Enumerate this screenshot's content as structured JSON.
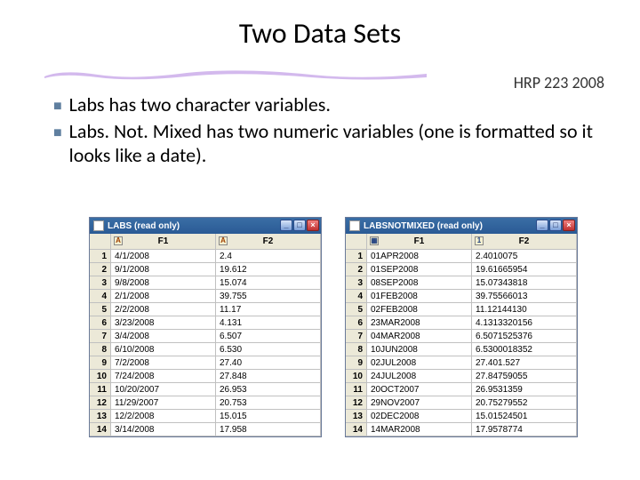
{
  "title": "Two Data Sets",
  "header_tag": "HRP 223 2008",
  "bullets": [
    "Labs has two character variables.",
    "Labs. Not. Mixed has two numeric variables (one is formatted so it looks like a date)."
  ],
  "windows": {
    "left": {
      "title": "LABS (read only)",
      "cols": [
        "F1",
        "F2"
      ],
      "coltypes": [
        "char",
        "char"
      ],
      "rows": [
        [
          "4/1/2008",
          "2.4"
        ],
        [
          "9/1/2008",
          "19.612"
        ],
        [
          "9/8/2008",
          "15.074"
        ],
        [
          "2/1/2008",
          "39.755"
        ],
        [
          "2/2/2008",
          "11.17"
        ],
        [
          "3/23/2008",
          "4.131"
        ],
        [
          "3/4/2008",
          "6.507"
        ],
        [
          "6/10/2008",
          "6.530"
        ],
        [
          "7/2/2008",
          "27.40"
        ],
        [
          "7/24/2008",
          "27.848"
        ],
        [
          "10/20/2007",
          "26.953"
        ],
        [
          "11/29/2007",
          "20.753"
        ],
        [
          "12/2/2008",
          "15.015"
        ],
        [
          "3/14/2008",
          "17.958"
        ]
      ]
    },
    "right": {
      "title": "LABSNOTMIXED (read only)",
      "cols": [
        "F1",
        "F2"
      ],
      "coltypes": [
        "date",
        "num"
      ],
      "rows": [
        [
          "01APR2008",
          "2.4010075"
        ],
        [
          "01SEP2008",
          "19.61665954"
        ],
        [
          "08SEP2008",
          "15.07343818"
        ],
        [
          "01FEB2008",
          "39.75566013"
        ],
        [
          "02FEB2008",
          "11.12144130"
        ],
        [
          "23MAR2008",
          "4.1313320156"
        ],
        [
          "04MAR2008",
          "6.5071525376"
        ],
        [
          "10JUN2008",
          "6.5300018352"
        ],
        [
          "02JUL2008",
          "27.401.527"
        ],
        [
          "24JUL2008",
          "27.84759055"
        ],
        [
          "20OCT2007",
          "26.9531359"
        ],
        [
          "29NOV2007",
          "20.75279552"
        ],
        [
          "02DEC2008",
          "15.01524501"
        ],
        [
          "14MAR2008",
          "17.9578774"
        ]
      ]
    }
  }
}
